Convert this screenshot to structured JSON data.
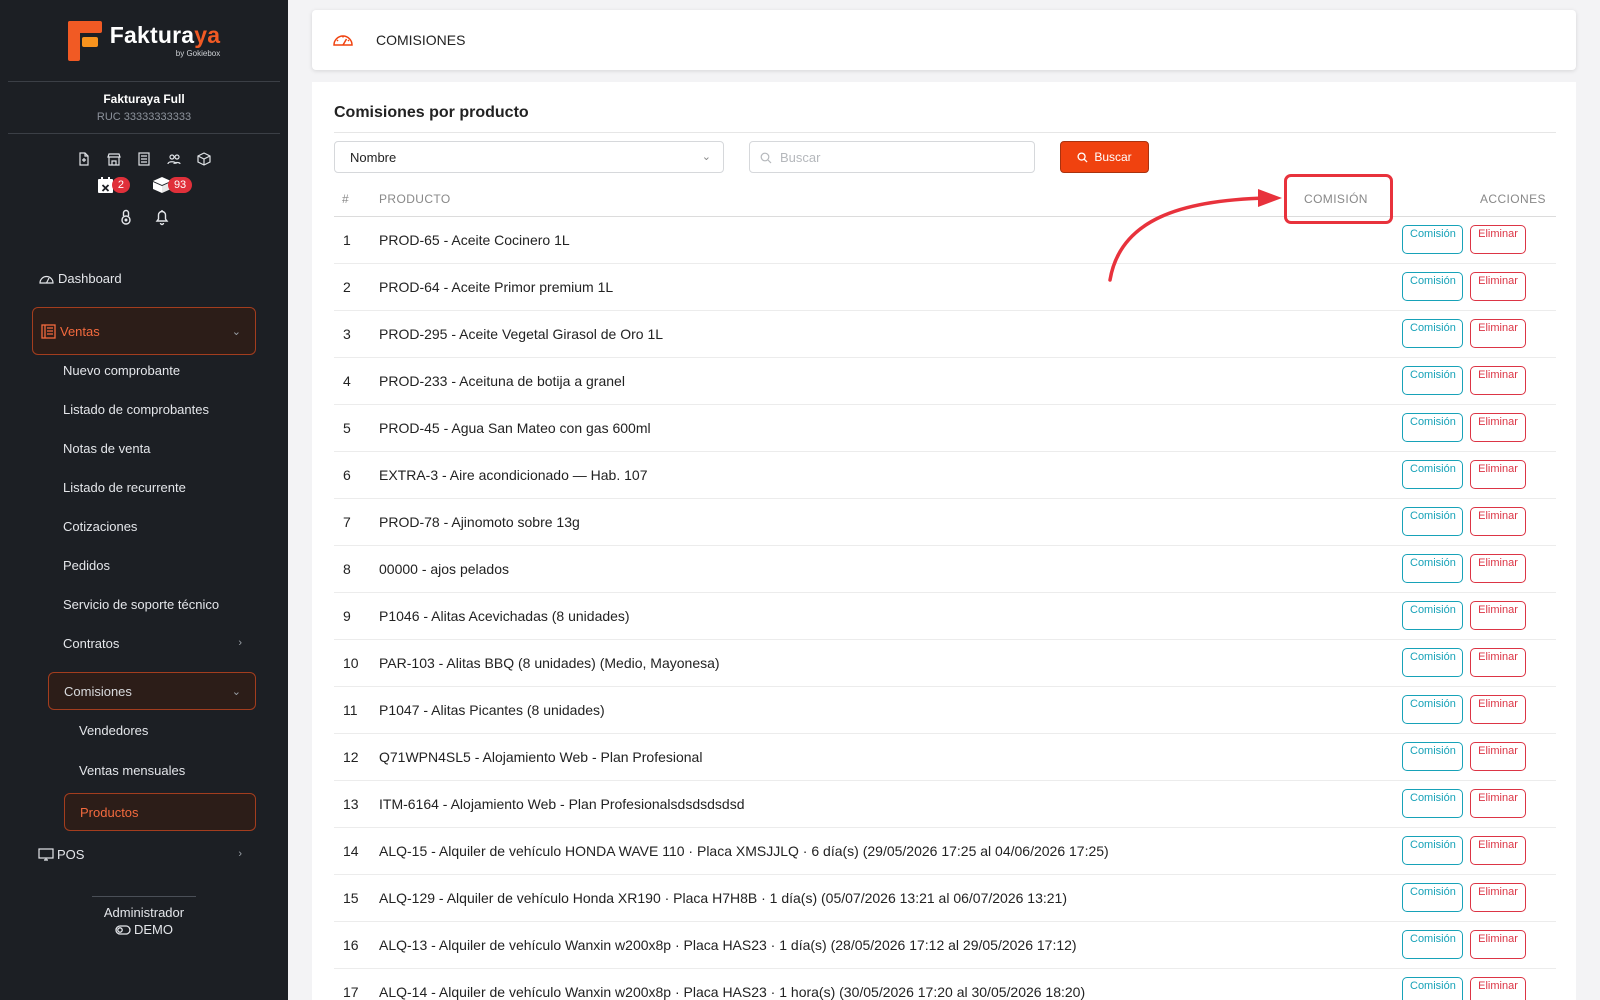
{
  "brand": {
    "name_main": "Faktura",
    "name_accent": "ya",
    "sub": "by Gokiebox"
  },
  "company": {
    "name": "Fakturaya Full",
    "ruc": "RUC 33333333333"
  },
  "badges": {
    "calendar": "2",
    "boxes": "93"
  },
  "menu": {
    "dashboard": "Dashboard",
    "ventas": "Ventas",
    "nuevo": "Nuevo comprobante",
    "listado": "Listado de comprobantes",
    "notas": "Notas de venta",
    "recurrente": "Listado de recurrente",
    "cotizaciones": "Cotizaciones",
    "pedidos": "Pedidos",
    "soporte": "Servicio de soporte técnico",
    "contratos": "Contratos",
    "comisiones": "Comisiones",
    "vendedores": "Vendedores",
    "mensuales": "Ventas mensuales",
    "productos": "Productos",
    "pos": "POS"
  },
  "user": {
    "role": "Administrador",
    "mode": "DEMO"
  },
  "topbar": {
    "title": "COMISIONES"
  },
  "panel": {
    "title": "Comisiones por producto",
    "filter_value": "Nombre",
    "search_placeholder": "Buscar",
    "search_button": "Buscar"
  },
  "table": {
    "headers": {
      "num": "#",
      "product": "PRODUCTO",
      "commission": "COMISIÓN",
      "actions": "ACCIONES"
    },
    "btn_commission": "Comisión",
    "btn_delete": "Eliminar",
    "rows": [
      {
        "n": "1",
        "product": "PROD-65 - Aceite Cocinero 1L"
      },
      {
        "n": "2",
        "product": "PROD-64 - Aceite Primor premium 1L"
      },
      {
        "n": "3",
        "product": "PROD-295 - Aceite Vegetal Girasol de Oro 1L"
      },
      {
        "n": "4",
        "product": "PROD-233 - Aceituna de botija a granel"
      },
      {
        "n": "5",
        "product": "PROD-45 - Agua San Mateo con gas 600ml"
      },
      {
        "n": "6",
        "product": "EXTRA-3 - Aire acondicionado — Hab. 107"
      },
      {
        "n": "7",
        "product": "PROD-78 - Ajinomoto sobre 13g"
      },
      {
        "n": "8",
        "product": "00000 - ajos pelados"
      },
      {
        "n": "9",
        "product": "P1046 - Alitas Acevichadas (8 unidades)"
      },
      {
        "n": "10",
        "product": "PAR-103 - Alitas BBQ (8 unidades) (Medio, Mayonesa)"
      },
      {
        "n": "11",
        "product": "P1047 - Alitas Picantes (8 unidades)"
      },
      {
        "n": "12",
        "product": "Q71WPN4SL5 - Alojamiento Web - Plan Profesional"
      },
      {
        "n": "13",
        "product": "ITM-6164 - Alojamiento Web - Plan Profesionalsdsdsdsdsd"
      },
      {
        "n": "14",
        "product": "ALQ-15 - Alquiler de vehículo HONDA WAVE 110 · Placa XMSJJLQ · 6 día(s) (29/05/2026 17:25 al 04/06/2026 17:25)"
      },
      {
        "n": "15",
        "product": "ALQ-129 - Alquiler de vehículo Honda XR190 · Placa H7H8B · 1 día(s) (05/07/2026 13:21 al 06/07/2026 13:21)"
      },
      {
        "n": "16",
        "product": "ALQ-13 - Alquiler de vehículo Wanxin w200x8p · Placa HAS23 · 1 día(s) (28/05/2026 17:12 al 29/05/2026 17:12)"
      },
      {
        "n": "17",
        "product": "ALQ-14 - Alquiler de vehículo Wanxin w200x8p · Placa HAS23 · 1 hora(s) (30/05/2026 17:20 al 30/05/2026 18:20)"
      }
    ]
  },
  "colors": {
    "accent": "#f0420f",
    "sidebar_bg": "#1c1f24",
    "commission_btn": "#17a2b8",
    "delete_btn": "#dc3545",
    "annotation": "#e8323c"
  }
}
